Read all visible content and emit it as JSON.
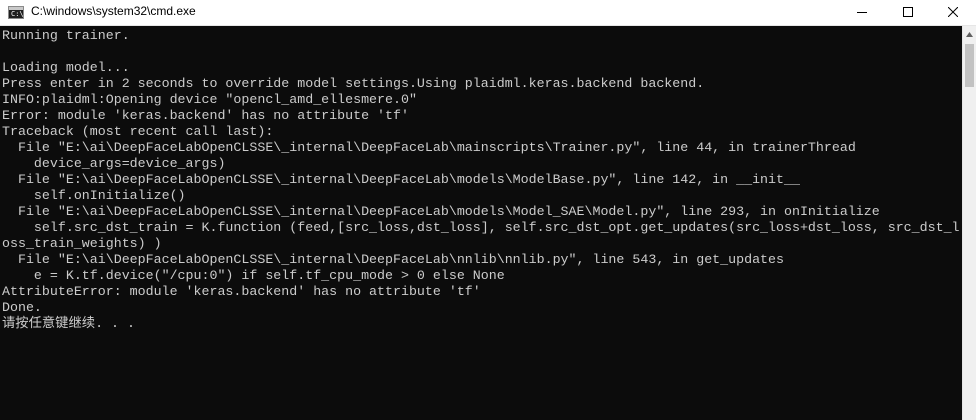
{
  "window": {
    "title": "C:\\windows\\system32\\cmd.exe",
    "icon": "cmd-icon",
    "icon_text": "C:\\"
  },
  "controls": {
    "minimize_icon": "minimize-icon",
    "maximize_icon": "maximize-icon",
    "close_icon": "close-icon"
  },
  "colors": {
    "console_background": "#0c0c0c",
    "console_text": "#cccccc",
    "titlebar_background": "#ffffff"
  },
  "console": {
    "lines": [
      "Running trainer.",
      "",
      "Loading model...",
      "Press enter in 2 seconds to override model settings.Using plaidml.keras.backend backend.",
      "INFO:plaidml:Opening device \"opencl_amd_ellesmere.0\"",
      "Error: module 'keras.backend' has no attribute 'tf'",
      "Traceback (most recent call last):",
      "  File \"E:\\ai\\DeepFaceLabOpenCLSSE\\_internal\\DeepFaceLab\\mainscripts\\Trainer.py\", line 44, in trainerThread",
      "    device_args=device_args)",
      "  File \"E:\\ai\\DeepFaceLabOpenCLSSE\\_internal\\DeepFaceLab\\models\\ModelBase.py\", line 142, in __init__",
      "    self.onInitialize()",
      "  File \"E:\\ai\\DeepFaceLabOpenCLSSE\\_internal\\DeepFaceLab\\models\\Model_SAE\\Model.py\", line 293, in onInitialize",
      "    self.src_dst_train = K.function (feed,[src_loss,dst_loss], self.src_dst_opt.get_updates(src_loss+dst_loss, src_dst_l",
      "oss_train_weights) )",
      "  File \"E:\\ai\\DeepFaceLabOpenCLSSE\\_internal\\DeepFaceLab\\nnlib\\nnlib.py\", line 543, in get_updates",
      "    e = K.tf.device(\"/cpu:0\") if self.tf_cpu_mode > 0 else None",
      "AttributeError: module 'keras.backend' has no attribute 'tf'",
      "Done.",
      "请按任意键继续. . ."
    ]
  },
  "scrollbar": {
    "up_arrow_icon": "scroll-up-arrow-icon"
  }
}
